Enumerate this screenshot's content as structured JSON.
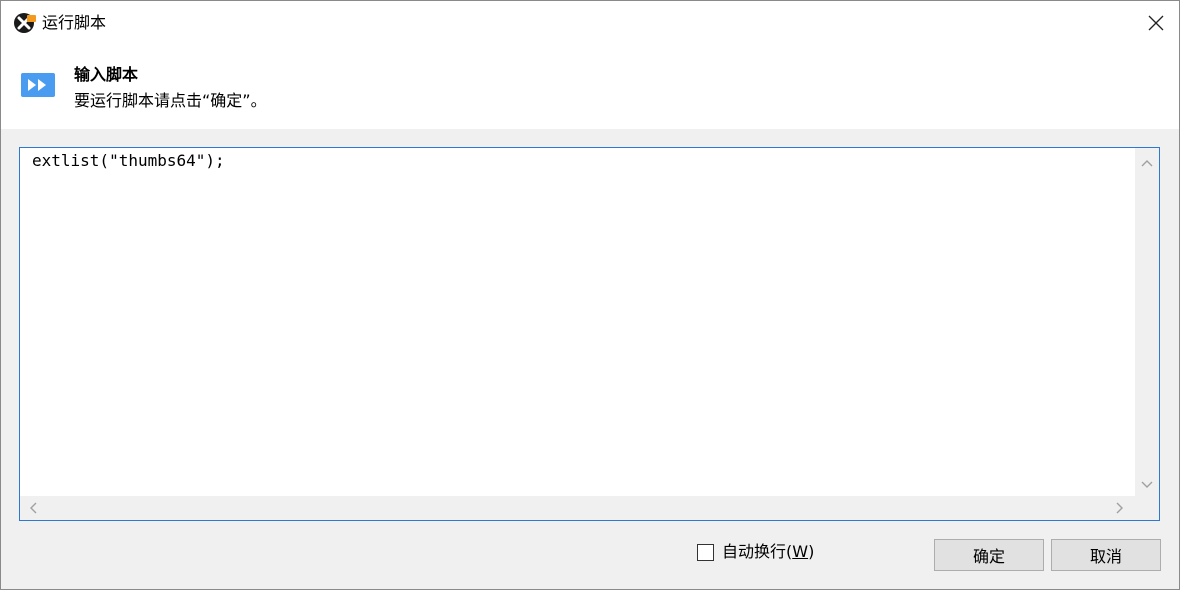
{
  "window": {
    "title": "运行脚本"
  },
  "header": {
    "title": "输入脚本",
    "description": "要运行脚本请点击“确定”。"
  },
  "editor": {
    "content": "extlist(\"thumbs64\");"
  },
  "options": {
    "word_wrap_label": "自动换行(",
    "word_wrap_mnemonic": "W",
    "word_wrap_suffix": ")"
  },
  "buttons": {
    "ok": "确定",
    "cancel": "取消"
  },
  "colors": {
    "accent": "#2b7ad0",
    "header_icon": "#4a9cf0"
  },
  "icons": {
    "app": "xyplorer-app-icon",
    "header": "run-script-icon",
    "close": "close-icon"
  }
}
